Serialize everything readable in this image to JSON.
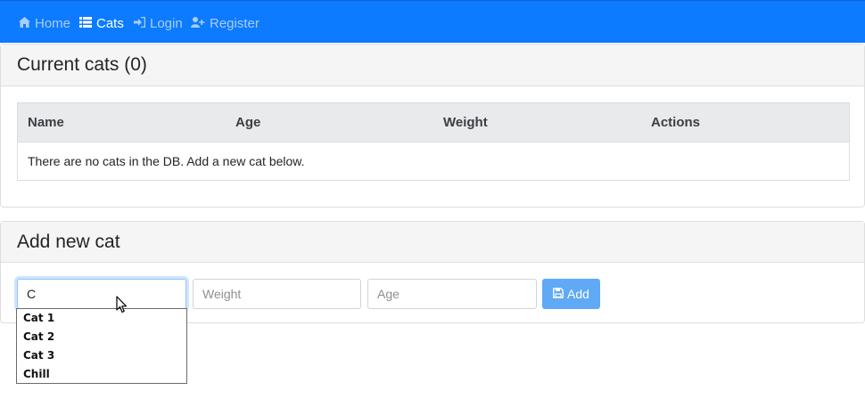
{
  "nav": {
    "items": [
      {
        "label": "Home",
        "icon": "home-icon",
        "active": false
      },
      {
        "label": "Cats",
        "icon": "list-icon",
        "active": true
      },
      {
        "label": "Login",
        "icon": "sign-in-icon",
        "active": false
      },
      {
        "label": "Register",
        "icon": "user-plus-icon",
        "active": false
      }
    ]
  },
  "current_cats": {
    "title": "Current cats (0)",
    "columns": [
      "Name",
      "Age",
      "Weight",
      "Actions"
    ],
    "empty_message": "There are no cats in the DB. Add a new cat below."
  },
  "add_cat": {
    "title": "Add new cat",
    "name_value": "C",
    "weight_placeholder": "Weight",
    "age_placeholder": "Age",
    "add_label": "Add"
  },
  "autocomplete": {
    "options": [
      "Cat 1",
      "Cat 2",
      "Cat 3",
      "Chill"
    ]
  },
  "colors": {
    "navbar": "#0d7bff",
    "add_button": "#5fa9f6"
  }
}
